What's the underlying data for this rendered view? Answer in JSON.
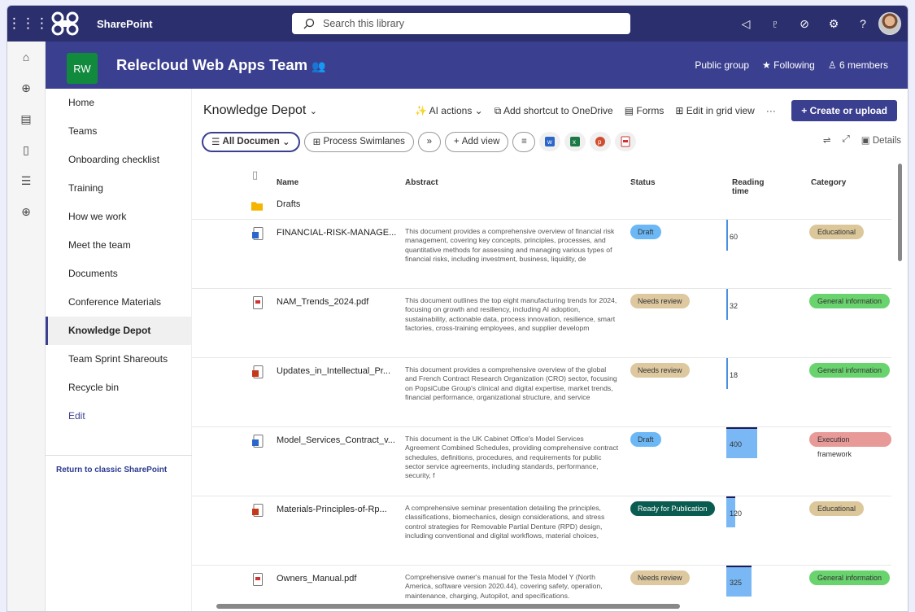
{
  "topbar": {
    "app_name": "SharePoint",
    "search_placeholder": "Search this library",
    "icons": [
      "megaphone-icon",
      "share-icon",
      "diagnostics-icon",
      "settings-icon",
      "help-icon"
    ]
  },
  "site": {
    "logo_text": "RW",
    "title": "Relecloud Web Apps Team",
    "privacy": "Public group",
    "following": "Following",
    "members": "6 members"
  },
  "nav": {
    "items": [
      "Home",
      "Teams",
      "Onboarding checklist",
      "Training",
      "How we work",
      "Meet the team",
      "Documents",
      "Conference Materials",
      "Knowledge Depot",
      "Team Sprint Shareouts",
      "Recycle bin",
      "Edit"
    ],
    "active": "Knowledge Depot",
    "classic_link": "Return to classic SharePoint"
  },
  "library": {
    "title": "Knowledge Depot",
    "commands": [
      "AI actions",
      "Add shortcut to OneDrive",
      "Forms",
      "Edit in grid view",
      "···"
    ],
    "create_label": "Create or upload",
    "views": [
      "All Documen",
      "Process Swimlanes"
    ],
    "add_view": "Add view",
    "details": "Details"
  },
  "columns": {
    "name": "Name",
    "abstract": "Abstract",
    "status": "Status",
    "reading": "Reading time",
    "category": "Category"
  },
  "folder": {
    "name": "Drafts"
  },
  "rows": [
    {
      "name": "FINANCIAL-RISK-MANAGE...",
      "type": "word",
      "abstract": "This document provides a comprehensive overview of financial risk management, covering key concepts, principles, processes, and quantitative methods for assessing and managing various types of financial risks, including investment, business, liquidity, de",
      "status": "Draft",
      "reading": "60",
      "category": "Educational"
    },
    {
      "name": "NAM_Trends_2024.pdf",
      "type": "pdf",
      "abstract": "This document outlines the top eight manufacturing trends for 2024, focusing on growth and resiliency, including AI adoption, sustainability, actionable data, process innovation, resilience, smart factories, cross-training employees, and supplier developm",
      "status": "Needs review",
      "reading": "32",
      "category": "General information"
    },
    {
      "name": "Updates_in_Intellectual_Pr...",
      "type": "ppt",
      "abstract": "This document provides a comprehensive overview of the global and French Contract Research Organization (CRO) sector, focusing on PopsiCube Group's clinical and digital expertise, market trends, financial performance, organizational structure, and service",
      "status": "Needs review",
      "reading": "18",
      "category": "General information"
    },
    {
      "name": "Model_Services_Contract_v...",
      "type": "word",
      "abstract": "This document is the UK Cabinet Office's Model Services Agreement Combined Schedules, providing comprehensive contract schedules, definitions, procedures, and requirements for public sector service agreements, including standards, performance, security, f",
      "status": "Draft",
      "reading": "400",
      "category": "Execution framework"
    },
    {
      "name": "Materials-Principles-of-Rp...",
      "type": "ppt",
      "abstract": "A comprehensive seminar presentation detailing the principles, classifications, biomechanics, design considerations, and stress control strategies for Removable Partial Denture (RPD) design, including conventional and digital workflows, material choices,",
      "status": "Ready for Publication",
      "reading": "120",
      "category": "Educational"
    },
    {
      "name": "Owners_Manual.pdf",
      "type": "pdf",
      "abstract": "Comprehensive owner's manual for the Tesla Model Y (North America, software version 2020.44), covering safety, operation, maintenance, charging, Autopilot, and specifications.",
      "status": "Needs review",
      "reading": "325",
      "category": "General information"
    }
  ],
  "colors": {
    "suite_bar": "#2b2f6e",
    "site_header": "#3a3f8f",
    "status_draft": "#6cb8f6",
    "status_review": "#ddc8a0",
    "status_ready": "#0b5c50",
    "cat_educational": "#dcc79a",
    "cat_general": "#69d36e",
    "cat_execution": "#e89a98",
    "reading_bar": "#79b8f4"
  }
}
